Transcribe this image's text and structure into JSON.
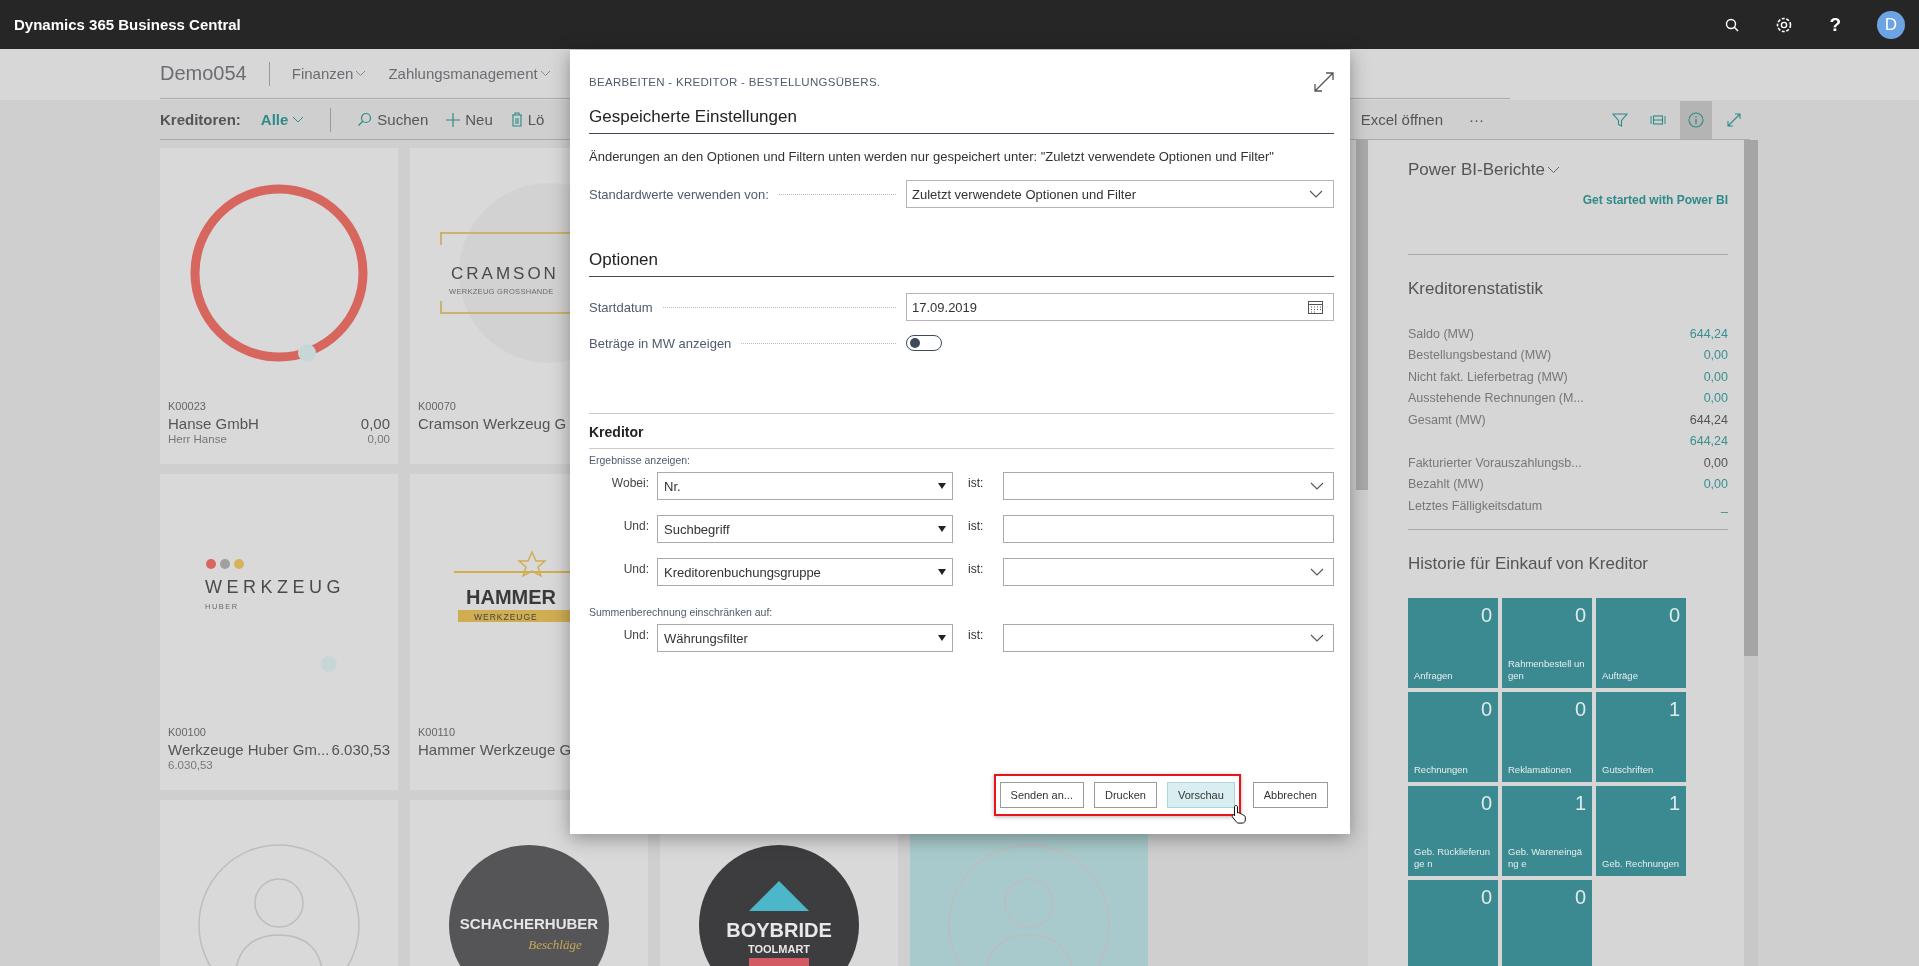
{
  "app_bar": {
    "title": "Dynamics 365 Business Central",
    "help_glyph": "?",
    "avatar_initial": "D"
  },
  "nav": {
    "company": "Demo054",
    "menus": [
      {
        "label": "Finanzen"
      },
      {
        "label": "Zahlungsmanagement"
      }
    ]
  },
  "toolbar": {
    "list_label": "Kreditoren:",
    "view": "Alle",
    "actions": [
      {
        "kind": "search",
        "label": "Suchen"
      },
      {
        "kind": "new",
        "label": "Neu"
      },
      {
        "kind": "delete",
        "label": "Lö"
      }
    ],
    "right_actions": [
      {
        "label": "Excel öffnen"
      },
      {
        "label": "···"
      }
    ],
    "icons": [
      {
        "kind": "filter",
        "selected": false
      },
      {
        "kind": "tile",
        "selected": false
      },
      {
        "kind": "info",
        "selected": true
      },
      {
        "kind": "expand",
        "selected": false
      }
    ]
  },
  "card_rows": [
    [
      {
        "number": "K00023",
        "name": "Hanse GmbH",
        "amount": "0,00",
        "contact": "Herr Hanse",
        "amount_2": "0,00",
        "selected": false,
        "logo": {
          "kind": "ring"
        }
      },
      {
        "number": "K00070",
        "name": "Cramson Werkzeug G",
        "selected": false,
        "logo": {
          "kind": "frame",
          "texts": [
            "CRAMSON",
            "WERKZEUG GROSSHANDE"
          ]
        }
      }
    ],
    [
      {
        "number": "K00100",
        "name": "Werkzeuge Huber Gm...",
        "amount": "6.030,53",
        "amount_2": "6.030,53",
        "selected": false,
        "logo": {
          "kind": "dots",
          "texts": [
            "WERKZEUG",
            "HUBER"
          ]
        }
      },
      {
        "number": "K00110",
        "name": "Hammer Werkzeuge G",
        "selected": false,
        "logo": {
          "kind": "star",
          "texts": [
            "HAMMER",
            "WERKZEUGE"
          ]
        }
      }
    ],
    [
      {
        "selected": false,
        "logo": {
          "kind": "avatar"
        }
      },
      {
        "selected": false,
        "logo": {
          "kind": "dark",
          "texts": [
            "SCHACHERHUBER",
            "Beschläge"
          ]
        }
      },
      {
        "selected": false,
        "logo": {
          "kind": "roof",
          "texts": [
            "BOYBRIDE",
            "TOOLMART"
          ]
        }
      },
      {
        "selected": true,
        "logo": {
          "kind": "avatar"
        }
      }
    ]
  ],
  "dialog": {
    "title": "BEARBEITEN - KREDITOR - BESTELLUNGSÜBERS.",
    "saved": {
      "heading": "Gespeicherte Einstellungen",
      "note": "Änderungen an den Optionen und Filtern unten werden nur gespeichert unter: \"Zuletzt verwendete Optionen und Filter\"",
      "label": "Standardwerte verwenden von:",
      "value": "Zuletzt verwendete Optionen und Filter"
    },
    "options": {
      "heading": "Optionen",
      "fields": [
        {
          "kind": "date",
          "label": "Startdatum",
          "value": "17.09.2019"
        },
        {
          "kind": "toggle",
          "label": "Beträge in MW anzeigen",
          "on": false
        }
      ]
    },
    "filters": {
      "heading": "Kreditor",
      "groups": [
        {
          "caption": "Ergebnisse anzeigen:",
          "rows": [
            {
              "conjunction": "Wobei:",
              "field": "Nr.",
              "operator": "ist:",
              "kind": "dropdown"
            },
            {
              "conjunction": "Und:",
              "field": "Suchbegriff",
              "operator": "ist:",
              "kind": "text"
            },
            {
              "conjunction": "Und:",
              "field": "Kreditorenbuchungsgruppe",
              "operator": "ist:",
              "kind": "dropdown"
            }
          ]
        },
        {
          "caption": "Summenberechnung einschränken auf:",
          "rows": [
            {
              "conjunction": "Und:",
              "field": "Währungsfilter",
              "operator": "ist:",
              "kind": "dropdown"
            }
          ]
        }
      ]
    },
    "button_groups": [
      {
        "framed": true,
        "buttons": [
          {
            "label": "Senden an...",
            "hovered": false
          },
          {
            "label": "Drucken",
            "hovered": false
          },
          {
            "label": "Vorschau",
            "hovered": true
          }
        ]
      },
      {
        "framed": false,
        "buttons": [
          {
            "label": "Abbrechen",
            "hovered": false
          }
        ]
      }
    ]
  },
  "factbox": {
    "powerbi": {
      "title": "Power BI-Berichte",
      "link": "Get started with Power BI"
    },
    "stats": {
      "title": "Kreditorenstatistik",
      "rows": [
        {
          "label": "Saldo (MW)",
          "value": "644,24",
          "link": true
        },
        {
          "label": "Bestellungsbestand (MW)",
          "value": "0,00",
          "link": true
        },
        {
          "label": "Nicht fakt. Lieferbetrag (MW)",
          "value": "0,00",
          "link": true
        },
        {
          "label": "Ausstehende Rechnungen (M...",
          "value": "0,00",
          "link": true
        },
        {
          "label": "Gesamt (MW)",
          "value": "644,24",
          "link": false
        },
        {
          "value": "644,24",
          "link": true
        },
        {
          "label": "Fakturierter Vorauszahlungsb...",
          "value": "0,00",
          "link": false
        },
        {
          "label": "Bezahlt (MW)",
          "value": "0,00",
          "link": true
        },
        {
          "label": "Letztes Fälligkeitsdatum",
          "value": "_",
          "link": true
        }
      ]
    },
    "history": {
      "title": "Historie für Einkauf von Kreditor",
      "tiles": [
        {
          "count": "0",
          "label": "Anfragen"
        },
        {
          "count": "0",
          "label": "Rahmenbestell ungen"
        },
        {
          "count": "0",
          "label": "Aufträge"
        },
        {
          "count": "0",
          "label": "Rechnungen"
        },
        {
          "count": "0",
          "label": "Reklamationen"
        },
        {
          "count": "1",
          "label": "Gutschriften"
        },
        {
          "count": "0",
          "label": "Geb. Rücklieferunge n"
        },
        {
          "count": "1",
          "label": "Geb. Wareneingäng e"
        },
        {
          "count": "1",
          "label": "Geb. Rechnungen"
        },
        {
          "count": "0"
        },
        {
          "count": "0"
        }
      ]
    }
  }
}
